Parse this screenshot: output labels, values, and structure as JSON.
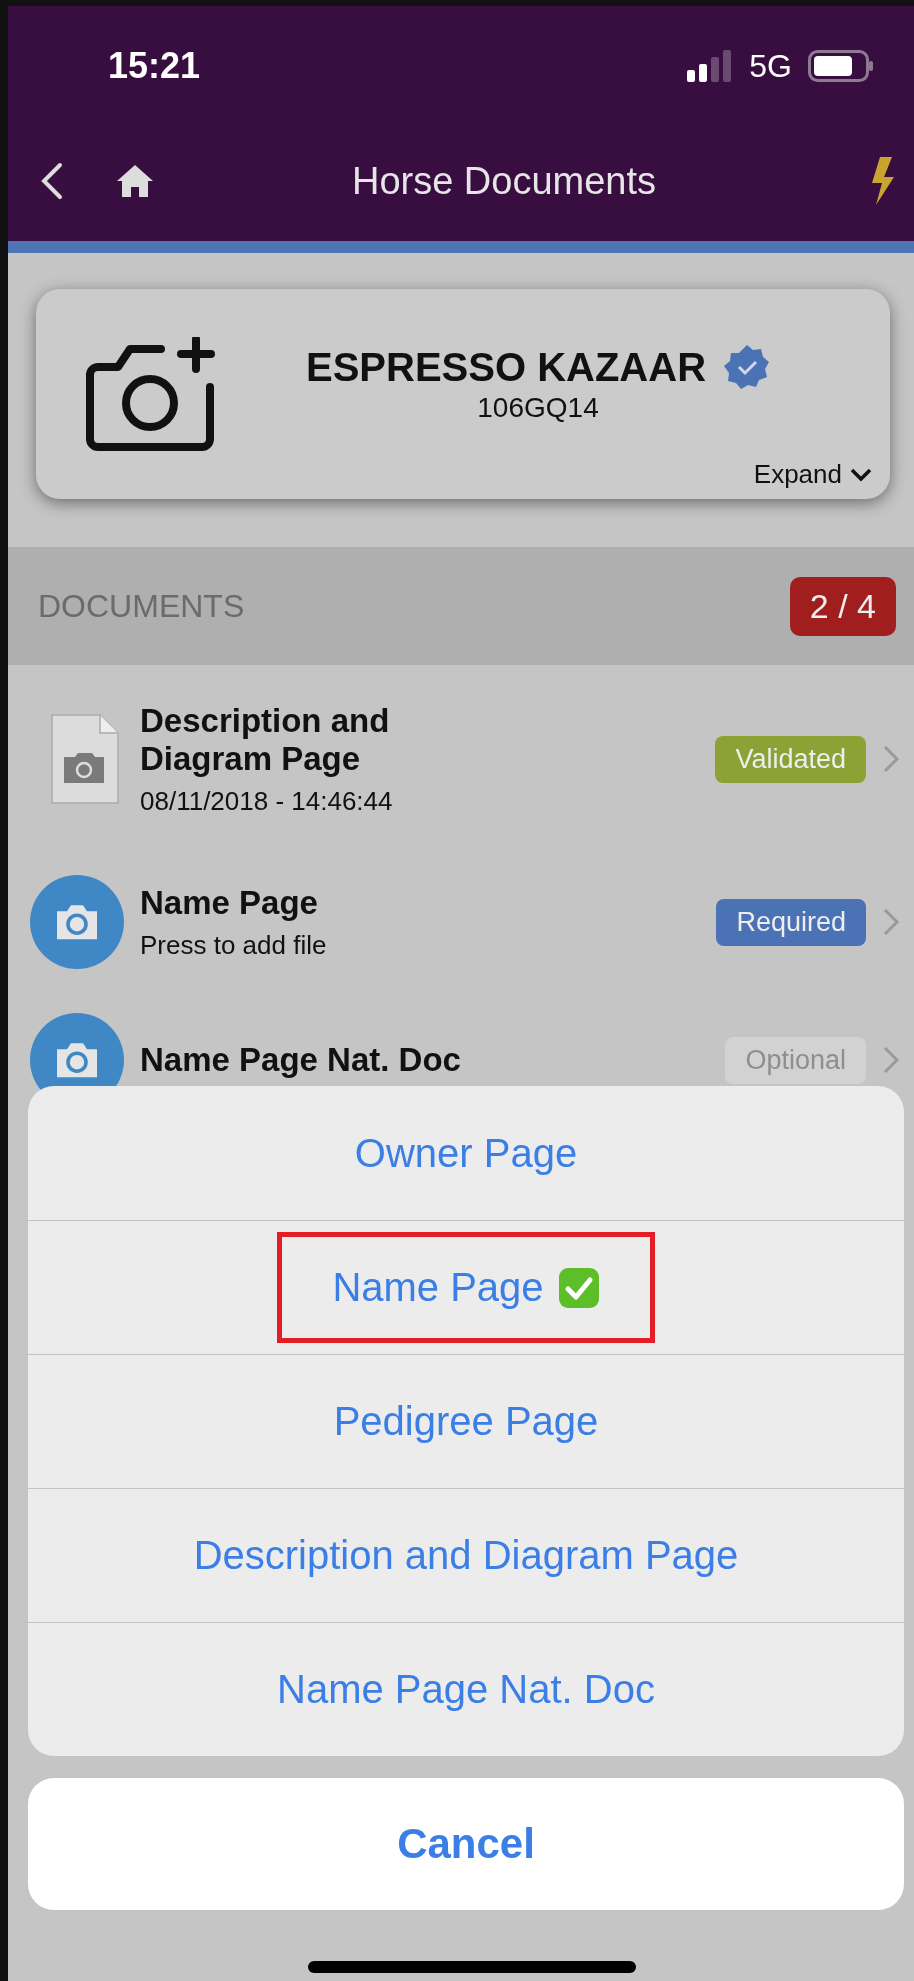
{
  "status_bar": {
    "time": "15:21",
    "network": "5G"
  },
  "nav": {
    "title": "Horse Documents"
  },
  "horse": {
    "name": "ESPRESSO KAZAAR",
    "verified": true,
    "code": "106GQ14",
    "expand_label": "Expand"
  },
  "documents": {
    "title": "DOCUMENTS",
    "count": "2 / 4",
    "items": [
      {
        "kind": "file",
        "title": "Description and Diagram Page",
        "subtitle": "08/11/2018 - 14:46:44",
        "badge": "Validated",
        "color": "#8da235",
        "faded": false
      },
      {
        "kind": "camera",
        "title": "Name Page",
        "subtitle": "Press to add file",
        "badge": "Required",
        "color": "#4a72b5",
        "faded": false
      },
      {
        "kind": "camera",
        "title": "Name Page Nat. Doc",
        "badge": "Optional",
        "color": "#d2d2d2",
        "faded": true
      }
    ]
  },
  "action_sheet": {
    "options": [
      {
        "label": "Owner Page",
        "checked": false,
        "highlighted": false
      },
      {
        "label": "Name Page",
        "checked": true,
        "highlighted": true
      },
      {
        "label": "Pedigree Page",
        "checked": false,
        "highlighted": false
      },
      {
        "label": "Description and Diagram Page",
        "checked": false,
        "highlighted": false
      },
      {
        "label": "Name Page Nat. Doc",
        "checked": false,
        "highlighted": false
      }
    ],
    "cancel": "Cancel"
  }
}
